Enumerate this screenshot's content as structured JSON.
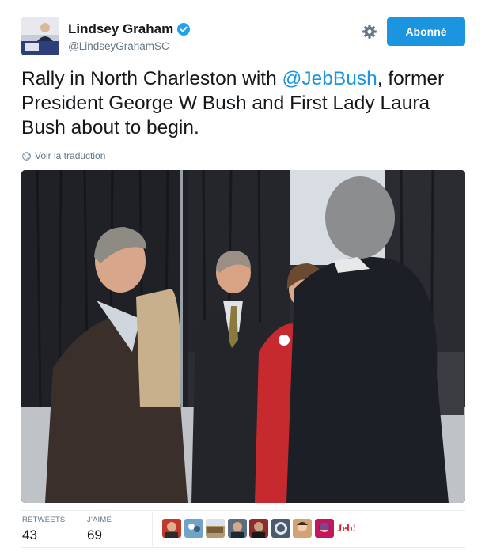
{
  "user": {
    "display_name": "Lindsey Graham",
    "handle": "@LindseyGrahamSC",
    "verified": true
  },
  "actions": {
    "follow_label": "Abonné",
    "settings_icon": "gear-icon"
  },
  "tweet": {
    "text_part1": "Rally in North Charleston with ",
    "mention": "@JebBush",
    "text_part2": ", former President George W Bush and First Lady Laura Bush about to begin.",
    "translate_label": "Voir la traduction",
    "media": "photo"
  },
  "stats": {
    "retweets_label": "RETWEETS",
    "retweets_count": "43",
    "likes_label": "J'AIME",
    "likes_count": "69"
  },
  "likers": [
    {
      "name": "liker-1",
      "color": "#c0392b"
    },
    {
      "name": "liker-2",
      "color": "#6fa3c8"
    },
    {
      "name": "liker-3",
      "color": "#b09a72"
    },
    {
      "name": "liker-4",
      "color": "#5d6d7e"
    },
    {
      "name": "liker-5",
      "color": "#8e2c2c"
    },
    {
      "name": "liker-6",
      "color": "#4b5a6e"
    },
    {
      "name": "liker-7",
      "color": "#d4a373"
    },
    {
      "name": "liker-8",
      "color": "#c2185b"
    }
  ],
  "jeb_logo": "Jeb!",
  "colors": {
    "accent": "#1b95e0",
    "text": "#14171a",
    "muted": "#657786",
    "jeb_red": "#d8232a"
  }
}
